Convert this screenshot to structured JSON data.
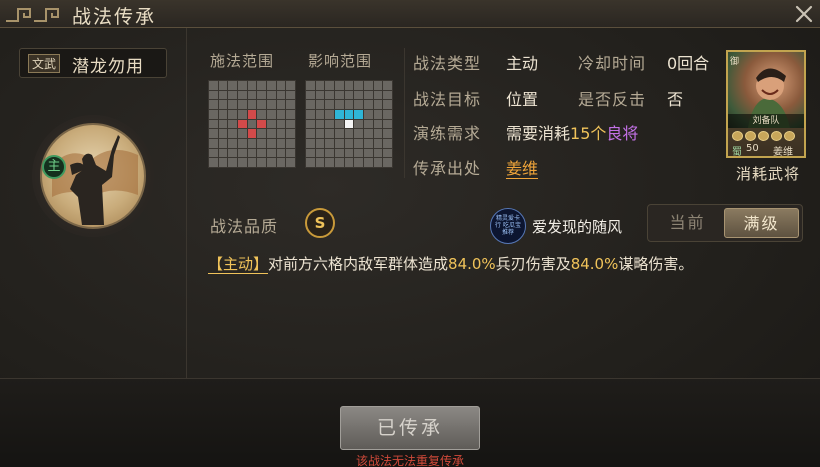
{
  "window": {
    "title": "战法传承"
  },
  "skill": {
    "type_tag": "文武",
    "name": "潜龙勿用",
    "main_badge": "主"
  },
  "ranges": {
    "cast_label": "施法范围",
    "effect_label": "影响范围"
  },
  "info": {
    "type_label": "战法类型",
    "type_value": "主动",
    "cooldown_label": "冷却时间",
    "cooldown_value": "0回合",
    "target_label": "战法目标",
    "target_value": "位置",
    "counter_label": "是否反击",
    "counter_value": "否",
    "train_label": "演练需求",
    "train_prefix": "需要消耗",
    "train_count": "15个",
    "train_item": "良将",
    "source_label": "传承出处",
    "source_value": "姜维"
  },
  "general_card": {
    "team": "刘备队",
    "faction": "蜀",
    "level": "50",
    "name": "姜维",
    "side_icon": "御",
    "stars": 5,
    "caption": "消耗武将"
  },
  "quality": {
    "label": "战法品质",
    "grade": "S"
  },
  "watermark": {
    "logo_text": "精灵爱卡行 吃瓜宝推荐",
    "text": "爱发现的随风"
  },
  "toggle": {
    "current": "当前",
    "max": "满级",
    "selected": "满级"
  },
  "description": {
    "tag": "【主动】",
    "part1": "对前方六格内敌军群体造成",
    "value1": "84.0%",
    "part2": "兵刃伤害及",
    "value2": "84.0%",
    "part3": "谋略伤害。"
  },
  "footer": {
    "button_label": "已传承",
    "warning": "该战法无法重复传承"
  },
  "colors": {
    "accent_gold": "#f0c35a",
    "link_orange": "#f0a53a",
    "warning_red": "#d14a3a",
    "purple": "#c371e6"
  }
}
